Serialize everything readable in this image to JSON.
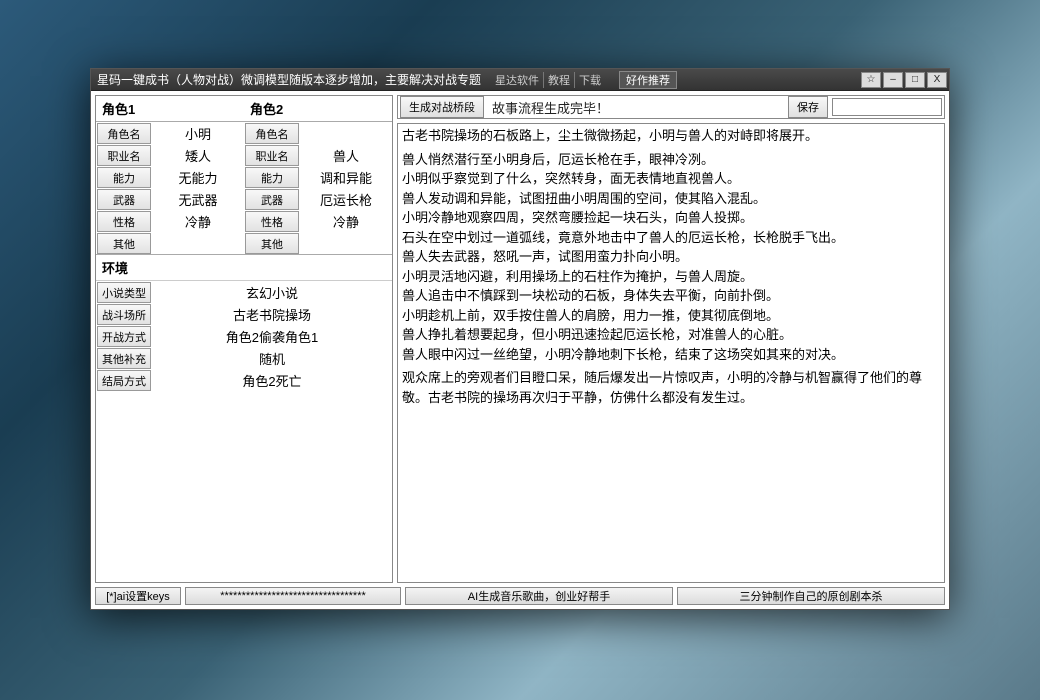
{
  "titlebar": {
    "title": "星码一键成书（人物对战）微调模型随版本逐步增加，主要解决对战专题",
    "links": [
      "星达软件",
      "教程",
      "下载"
    ],
    "good": "好作推荐",
    "buttons": {
      "star": "☆",
      "min": "–",
      "max": "□",
      "close": "X"
    }
  },
  "characters": {
    "header": {
      "label1": "角色1",
      "label2": "角色2"
    },
    "rows": [
      {
        "btn": "角色名",
        "v1": "小明",
        "v2": ""
      },
      {
        "btn": "职业名",
        "v1": "矮人",
        "v2": "兽人"
      },
      {
        "btn": "能力",
        "v1": "无能力",
        "v2": "调和异能"
      },
      {
        "btn": "武器",
        "v1": "无武器",
        "v2": "厄运长枪"
      },
      {
        "btn": "性格",
        "v1": "冷静",
        "v2": "冷静"
      },
      {
        "btn": "其他",
        "v1": "",
        "v2": ""
      }
    ]
  },
  "env": {
    "title": "环境",
    "rows": [
      {
        "label": "小说类型",
        "value": "玄幻小说"
      },
      {
        "label": "战斗场所",
        "value": "古老书院操场"
      },
      {
        "label": "开战方式",
        "value": "角色2偷袭角色1"
      },
      {
        "label": "其他补充",
        "value": "随机"
      },
      {
        "label": "结局方式",
        "value": "角色2死亡"
      }
    ]
  },
  "right": {
    "gen_button": "生成对战桥段",
    "status": "故事流程生成完毕！",
    "save_button": "保存",
    "save_value": ""
  },
  "story": {
    "p1": "古老书院操场的石板路上，尘土微微扬起，小明与兽人的对峙即将展开。",
    "p2": "兽人悄然潜行至小明身后，厄运长枪在手，眼神冷冽。\n小明似乎察觉到了什么，突然转身，面无表情地直视兽人。\n兽人发动调和异能，试图扭曲小明周围的空间，使其陷入混乱。\n小明冷静地观察四周，突然弯腰捡起一块石头，向兽人投掷。\n石头在空中划过一道弧线，竟意外地击中了兽人的厄运长枪，长枪脱手飞出。\n兽人失去武器，怒吼一声，试图用蛮力扑向小明。\n小明灵活地闪避，利用操场上的石柱作为掩护，与兽人周旋。\n兽人追击中不慎踩到一块松动的石板，身体失去平衡，向前扑倒。\n小明趁机上前，双手按住兽人的肩膀，用力一推，使其彻底倒地。\n兽人挣扎着想要起身，但小明迅速捡起厄运长枪，对准兽人的心脏。\n兽人眼中闪过一丝绝望，小明冷静地刺下长枪，结束了这场突如其来的对决。",
    "p3": "观众席上的旁观者们目瞪口呆，随后爆发出一片惊叹声，小明的冷静与机智赢得了他们的尊敬。古老书院的操场再次归于平静，仿佛什么都没有发生过。"
  },
  "bottom": {
    "keys": "[*]ai设置keys",
    "stars": "**********************************",
    "mid": "AI生成音乐歌曲，创业好帮手",
    "right": "三分钟制作自己的原创剧本杀"
  }
}
